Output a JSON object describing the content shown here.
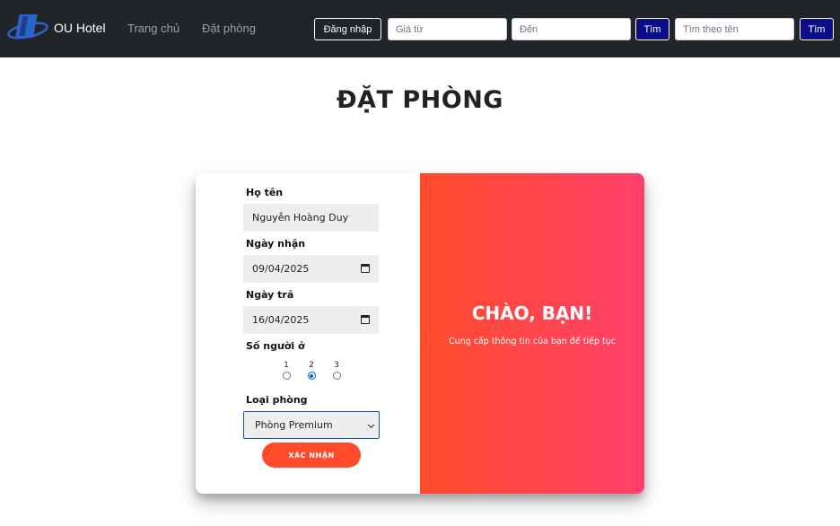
{
  "navbar": {
    "brand": "OU Hotel",
    "links": [
      "Trang chủ",
      "Đặt phòng"
    ],
    "login_label": "Đăng nhập",
    "price_from_placeholder": "Giá từ",
    "price_to_placeholder": "Đến",
    "search_label_1": "Tìm",
    "name_search_placeholder": "Tìm theo tên",
    "search_label_2": "Tìm"
  },
  "page": {
    "title": "ĐẶT PHÒNG"
  },
  "form": {
    "fullname_label": "Họ tên",
    "fullname_value": "Nguyễn Hoàng Duy",
    "checkin_label": "Ngày nhận",
    "checkin_value": "09/04/2025",
    "checkout_label": "Ngày trả",
    "checkout_value": "16/04/2025",
    "guests_label": "Số người ở",
    "guest_options": [
      "1",
      "2",
      "3"
    ],
    "guests_selected": "2",
    "room_type_label": "Loại phòng",
    "room_type_selected": "Phòng Premium",
    "submit_label": "XÁC NHẬN"
  },
  "overlay": {
    "title": "CHÀO, BẠN!",
    "text": "Cung cấp thông tin của bạn để tiếp tục"
  },
  "colors": {
    "navbar_bg": "#212529",
    "accent": "#ff4b2b",
    "gradient_end": "#ff416c",
    "search_button": "#0d0d8a"
  }
}
